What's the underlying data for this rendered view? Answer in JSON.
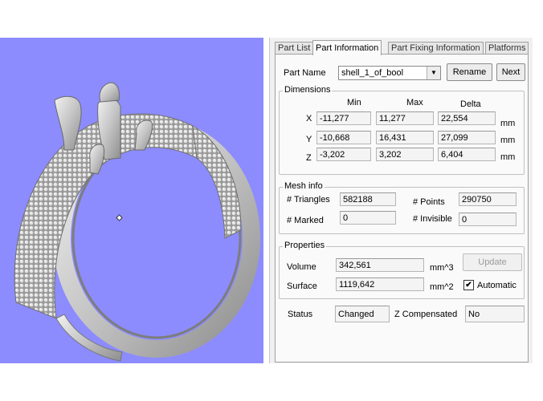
{
  "tabs": [
    "Part List",
    "Part Information",
    "Part Fixing Information",
    "Platforms"
  ],
  "part": {
    "label": "Part Name",
    "value": "shell_1_of_bool",
    "rename": "Rename",
    "next": "Next"
  },
  "dimensions": {
    "title": "Dimensions",
    "headers": [
      "Min",
      "Max",
      "Delta"
    ],
    "rows": [
      {
        "axis": "X",
        "min": "-11,277",
        "max": "11,277",
        "delta": "22,554",
        "unit": "mm"
      },
      {
        "axis": "Y",
        "min": "-10,668",
        "max": "16,431",
        "delta": "27,099",
        "unit": "mm"
      },
      {
        "axis": "Z",
        "min": "-3,202",
        "max": "3,202",
        "delta": "6,404",
        "unit": "mm"
      }
    ]
  },
  "mesh": {
    "title": "Mesh info",
    "triangles_label": "# Triangles",
    "triangles": "582188",
    "points_label": "# Points",
    "points": "290750",
    "marked_label": "# Marked",
    "marked": "0",
    "invisible_label": "# Invisible",
    "invisible": "0"
  },
  "properties": {
    "title": "Properties",
    "volume_label": "Volume",
    "volume": "342,561",
    "volume_unit": "mm^3",
    "surface_label": "Surface",
    "surface": "1119,642",
    "surface_unit": "mm^2",
    "update": "Update",
    "automatic_label": "Automatic",
    "automatic_checked": true
  },
  "status": {
    "label": "Status",
    "value": "Changed",
    "zcomp_label": "Z Compensated",
    "zcomp_value": "No"
  },
  "icons": {
    "check": "✔",
    "dropdown": "▼"
  },
  "colors": {
    "viewport": "#8c8cff"
  }
}
